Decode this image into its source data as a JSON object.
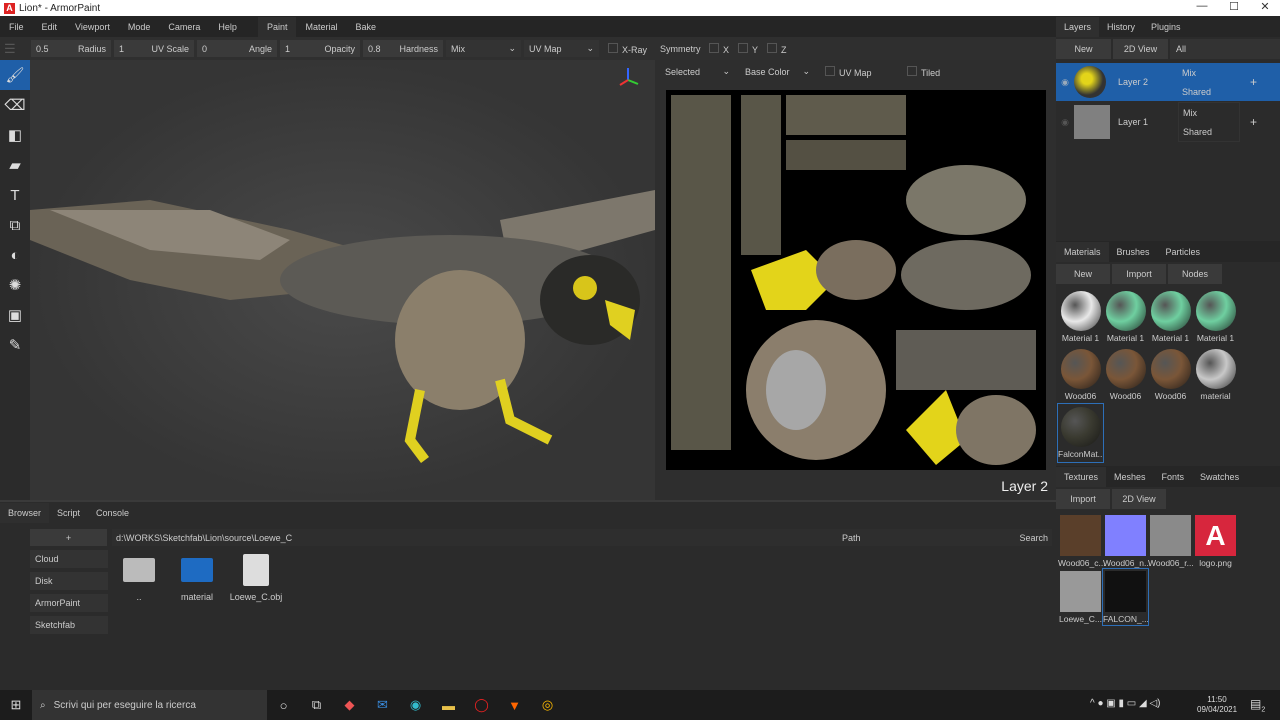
{
  "window": {
    "title": "Lion* - ArmorPaint",
    "minimize": "—",
    "maximize": "☐",
    "close": "✕"
  },
  "menu": [
    "File",
    "Edit",
    "Viewport",
    "Mode",
    "Camera",
    "Help"
  ],
  "workspaces": [
    "Paint",
    "Material",
    "Bake"
  ],
  "toolbar": {
    "radius_value": "0.5",
    "radius_label": "Radius",
    "uvscale_value": "1",
    "uvscale_label": "UV Scale",
    "angle_value": "0",
    "angle_label": "Angle",
    "opacity_value": "1",
    "opacity_label": "Opacity",
    "hardness_value": "0.8",
    "hardness_label": "Hardness",
    "blend": "Mix",
    "uv": "UV Map",
    "xray": "X-Ray",
    "symmetry": "Symmetry",
    "x": "X",
    "y": "Y",
    "z": "Z"
  },
  "uv_bar": {
    "selected": "Selected",
    "channel": "Base Color",
    "uvmap": "UV Map",
    "tiled": "Tiled"
  },
  "viewport": {
    "layer_label": "Layer 2"
  },
  "layers_panel": {
    "tabs": [
      "Layers",
      "History",
      "Plugins"
    ],
    "new": "New",
    "view2d": "2D View",
    "filter": "All",
    "layers": [
      {
        "name": "Layer 2",
        "blend": "Mix",
        "mode": "Shared"
      },
      {
        "name": "Layer 1",
        "blend": "Mix",
        "mode": "Shared"
      }
    ],
    "add": "+"
  },
  "materials_panel": {
    "tabs": [
      "Materials",
      "Brushes",
      "Particles"
    ],
    "new": "New",
    "import": "Import",
    "nodes": "Nodes",
    "items": [
      {
        "name": "Material 1",
        "color": "#e8e8e8"
      },
      {
        "name": "Material 1",
        "color": "#6fcfa0"
      },
      {
        "name": "Material 1",
        "color": "#6fcfa0"
      },
      {
        "name": "Material 1",
        "color": "#6fcfa0"
      },
      {
        "name": "Wood06",
        "color": "#7a5638"
      },
      {
        "name": "Wood06",
        "color": "#7a5638"
      },
      {
        "name": "Wood06",
        "color": "#7a5638"
      },
      {
        "name": "material",
        "color": "#c8c8c8"
      },
      {
        "name": "FalconMat...",
        "color": "#3a3a30"
      }
    ]
  },
  "textures_panel": {
    "tabs": [
      "Textures",
      "Meshes",
      "Fonts",
      "Swatches"
    ],
    "import": "Import",
    "view2d": "2D View",
    "items": [
      {
        "name": "Wood06_c...",
        "color": "#5a3f2a"
      },
      {
        "name": "Wood06_n...",
        "color": "#8080ff"
      },
      {
        "name": "Wood06_r...",
        "color": "#8a8a8a"
      },
      {
        "name": "logo.png",
        "color": "#d7263d"
      },
      {
        "name": "Loewe_C...",
        "color": "#999"
      },
      {
        "name": "FALCON_...",
        "color": "#111"
      }
    ],
    "logo_letter": "A"
  },
  "browser": {
    "tabs": [
      "Browser",
      "Script",
      "Console"
    ],
    "add": "+",
    "path": "d:\\WORKS\\Sketchfab\\Lion\\source\\Loewe_C",
    "path_label": "Path",
    "search_label": "Search",
    "locations": [
      "Cloud",
      "Disk",
      "ArmorPaint",
      "Sketchfab"
    ],
    "files": [
      {
        "name": "..",
        "type": "folder-up"
      },
      {
        "name": "material",
        "type": "folder"
      },
      {
        "name": "Loewe_C.obj",
        "type": "file"
      }
    ]
  },
  "taskbar": {
    "search": "Scrivi qui per eseguire la ricerca",
    "time": "11:50",
    "date": "09/04/2021",
    "notifications": "2"
  }
}
